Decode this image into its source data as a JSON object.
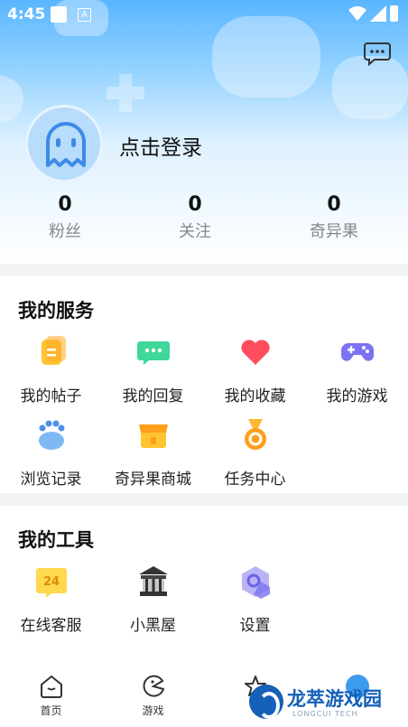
{
  "status_bar": {
    "time": "4:45",
    "a_icon": "A"
  },
  "profile": {
    "login_label": "点击登录"
  },
  "stats": [
    {
      "value": "0",
      "label": "粉丝"
    },
    {
      "value": "0",
      "label": "关注"
    },
    {
      "value": "0",
      "label": "奇异果"
    }
  ],
  "services": {
    "title": "我的服务",
    "items": [
      {
        "label": "我的帖子",
        "icon": "post-icon"
      },
      {
        "label": "我的回复",
        "icon": "reply-icon"
      },
      {
        "label": "我的收藏",
        "icon": "favorite-heart-icon"
      },
      {
        "label": "我的游戏",
        "icon": "gamepad-icon"
      },
      {
        "label": "浏览记录",
        "icon": "paw-history-icon"
      },
      {
        "label": "奇异果商城",
        "icon": "shop-icon"
      },
      {
        "label": "任务中心",
        "icon": "medal-icon"
      }
    ]
  },
  "tools": {
    "title": "我的工具",
    "items": [
      {
        "label": "在线客服",
        "icon": "service-24-icon",
        "badge": "24"
      },
      {
        "label": "小黑屋",
        "icon": "jail-house-icon"
      },
      {
        "label": "设置",
        "icon": "settings-hex-icon"
      }
    ]
  },
  "tabbar": [
    {
      "label": "首页",
      "icon": "home-icon"
    },
    {
      "label": "游戏",
      "icon": "game-pacman-icon"
    },
    {
      "label": "",
      "icon": "star-icon"
    },
    {
      "label": "",
      "icon": "profile-icon"
    }
  ],
  "watermark": {
    "text": "龙萃游戏园",
    "sub": "LONGCUI TECH"
  }
}
